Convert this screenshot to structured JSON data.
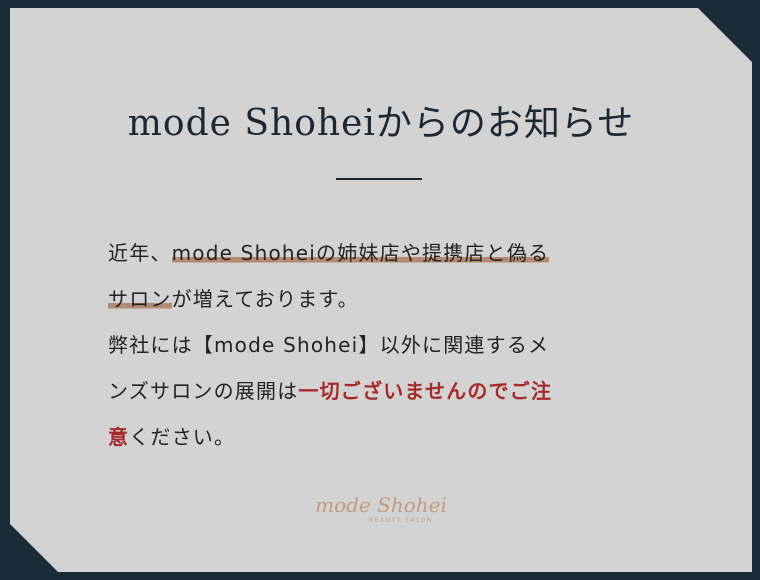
{
  "title": "mode Shoheiからのお知らせ",
  "notice": {
    "line1_a": "近年、",
    "line1_b": "mode Shoheiの姉妹店や提携店と偽る",
    "line2_a": "サロン",
    "line2_b": "が増えております。",
    "line3": "弊社には【mode Shohei】以外に関連するメ",
    "line4_a": "ンズサロンの展開は",
    "line4_b": "一切ございませんのでご注",
    "line5_a": "意",
    "line5_b": "ください。"
  },
  "logo": {
    "main": "mode Shohei",
    "sub": "BEAUTY SALON"
  },
  "colors": {
    "frame": "#1a2b38",
    "card": "#d3d3d4",
    "highlight": "#b58a70",
    "emphasis": "#a62a2a",
    "logo": "#c4997d"
  }
}
